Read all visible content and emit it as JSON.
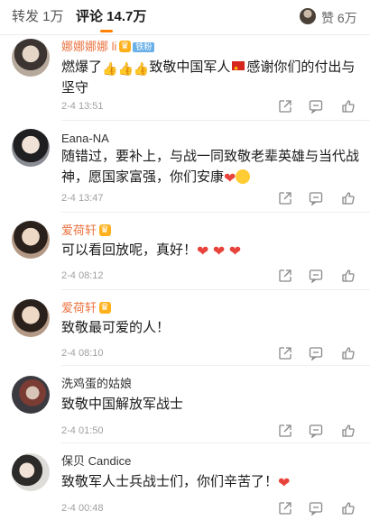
{
  "tabs": {
    "reposts": "转发 1万",
    "comments": "评论 14.7万",
    "likes": "赞 6万"
  },
  "comments": [
    {
      "name": "娜娜娜娜 li",
      "fan_badge": "铁粉",
      "text_before": "燃爆了",
      "text_after": "致敬中国军人",
      "text_end": "感谢你们的付出与坚守",
      "time": "2-4 13:51"
    },
    {
      "name": "Eana-NA",
      "text": "随错过，要补上，与战一同致敬老辈英雄与当代战神，愿国家富强，你们安康",
      "time": "2-4 13:47"
    },
    {
      "name": "爱荷轩",
      "text": "可以看回放呢，真好！",
      "time": "2-4 08:12"
    },
    {
      "name": "爱荷轩",
      "text": "致敬最可爱的人！",
      "time": "2-4 08:10"
    },
    {
      "name": "洗鸡蛋的姑娘",
      "text": "致敬中国解放军战士",
      "time": "2-4 01:50"
    },
    {
      "name": "保贝 Candice",
      "text": "致敬军人士兵战士们，你们辛苦了！",
      "time": "2-4 00:48"
    }
  ],
  "icons": {
    "share": "share-icon",
    "comment": "comment-icon",
    "like": "thumbs-up-icon"
  },
  "colors": {
    "accent": "#ff8200",
    "vip_name": "#eb7340",
    "heart": "#e8433b"
  }
}
